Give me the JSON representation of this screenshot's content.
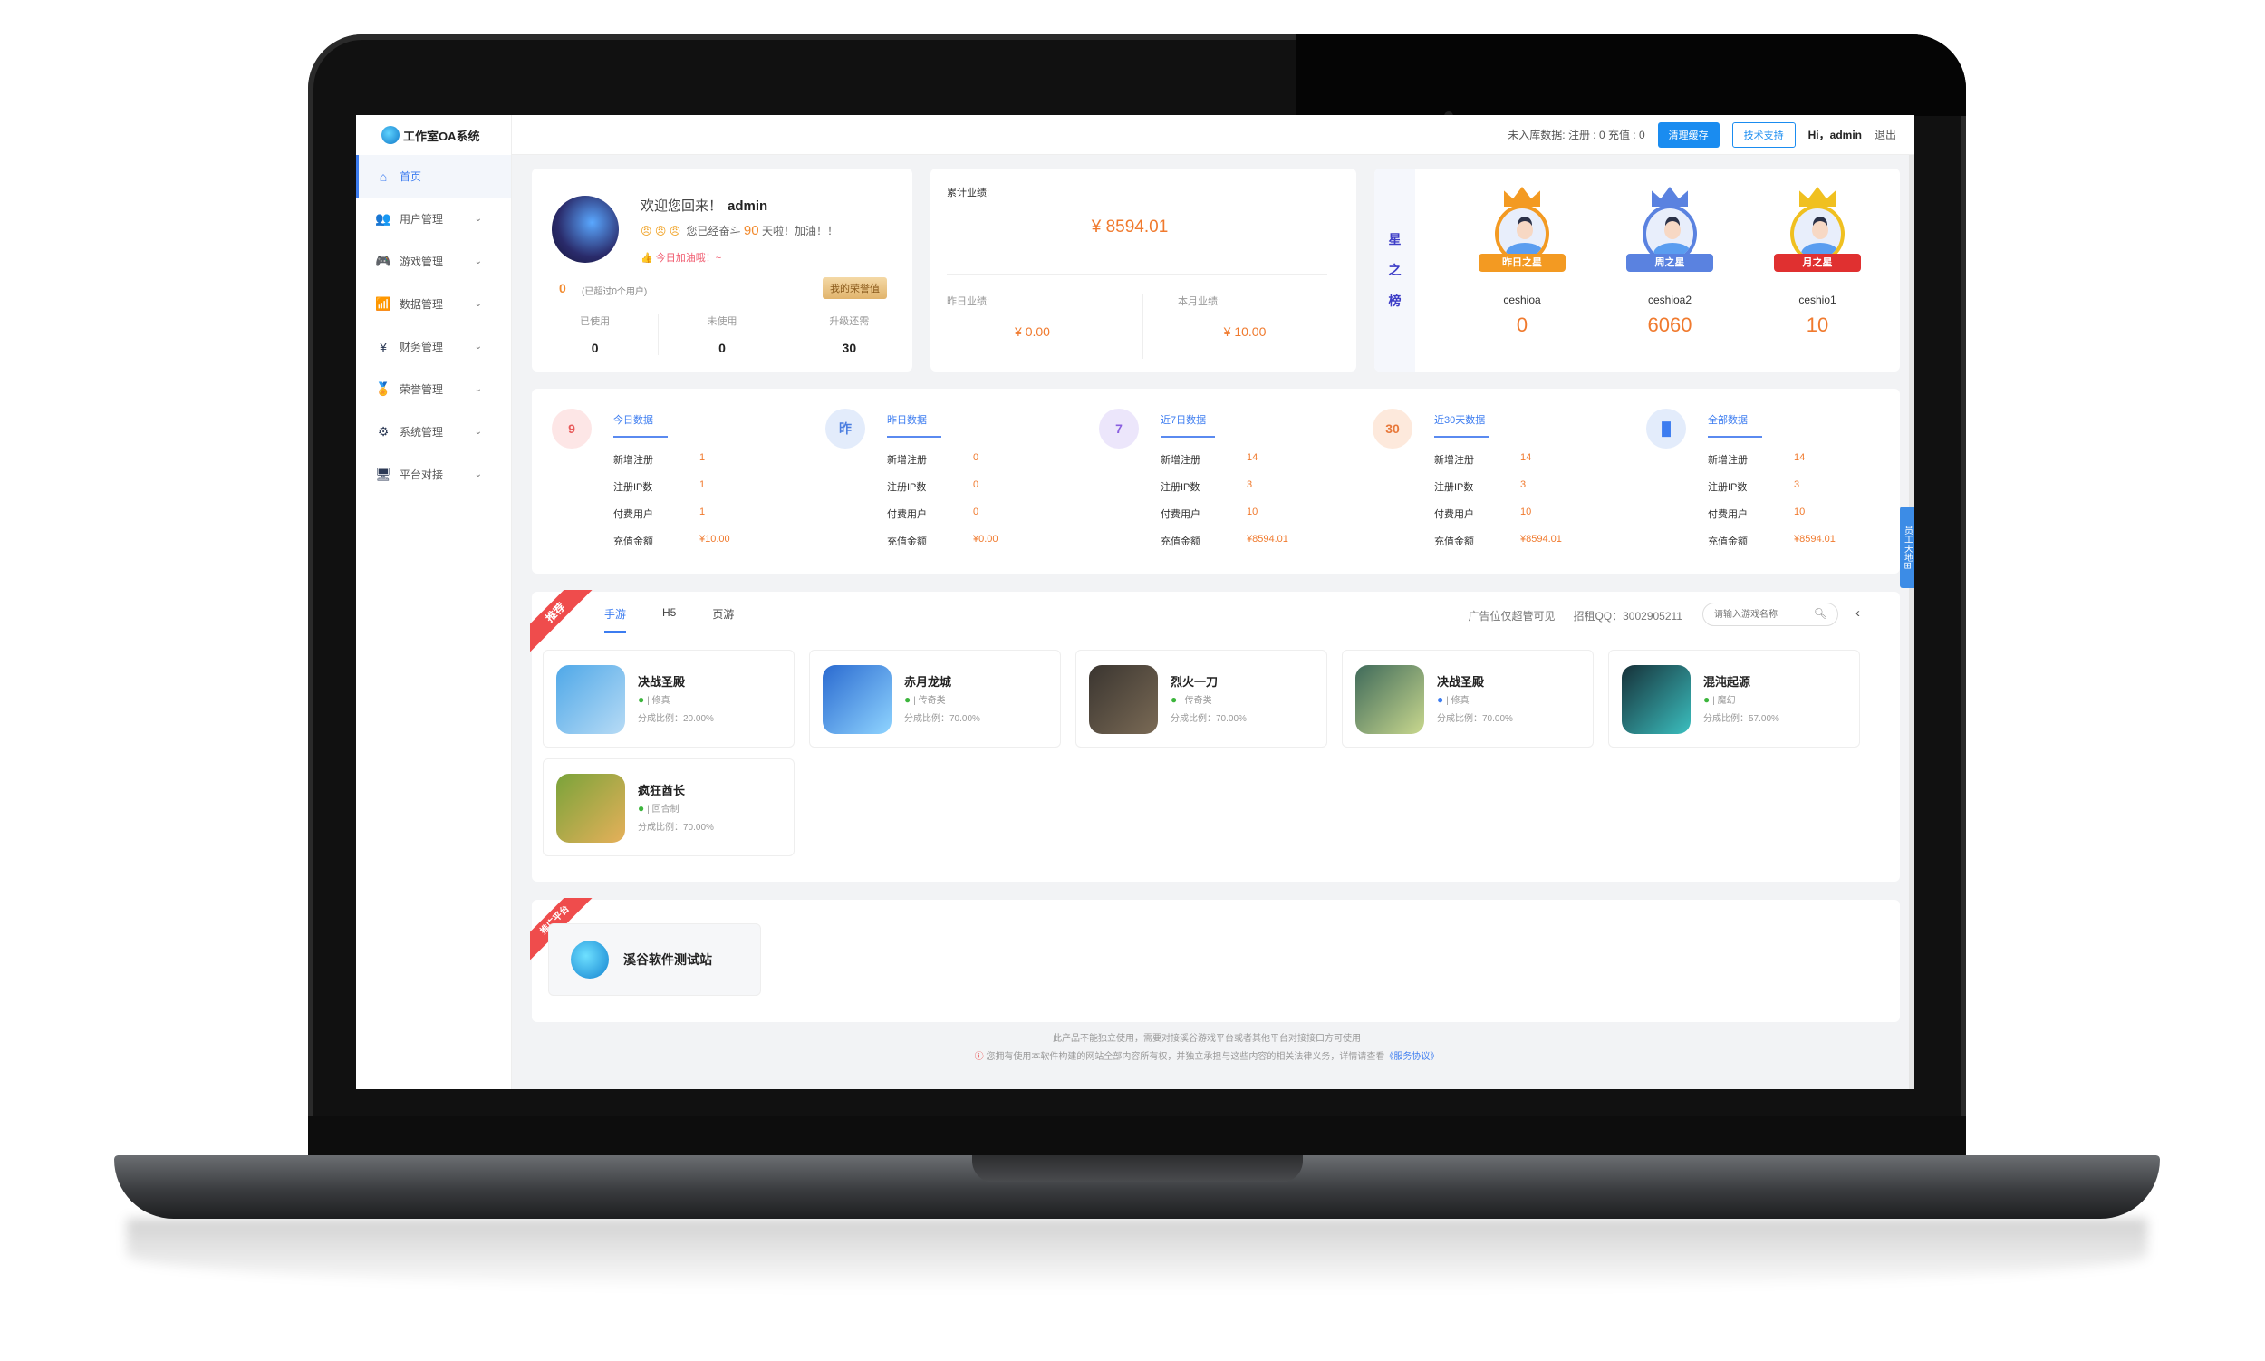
{
  "app": {
    "title": "工作室OA系统"
  },
  "sidebar": {
    "items": [
      {
        "label": "首页",
        "icon": "home-icon",
        "active": true
      },
      {
        "label": "用户管理",
        "icon": "users-icon"
      },
      {
        "label": "游戏管理",
        "icon": "gamepad-icon"
      },
      {
        "label": "数据管理",
        "icon": "chart-icon"
      },
      {
        "label": "财务管理",
        "icon": "yuan-icon"
      },
      {
        "label": "荣誉管理",
        "icon": "medal-icon"
      },
      {
        "label": "系统管理",
        "icon": "gear-icon"
      },
      {
        "label": "平台对接",
        "icon": "monitor-icon"
      }
    ]
  },
  "topbar": {
    "pending": "未入库数据: 注册 : 0 充值 : 0",
    "clear_cache": "清理缓存",
    "tech_support": "技术支持",
    "greeting": "Hi，admin",
    "logout": "退出"
  },
  "user_card": {
    "welcome": "欢迎您回来！",
    "username": "admin",
    "emojis": "😠 😠 😠",
    "fight_prefix": "您已经奋斗",
    "days": "90",
    "fight_suffix": "天啦！加油！！",
    "cheer": "👍 今日加油哦！~",
    "score": "0",
    "score_sub": "(已超过0个用户)",
    "honor_button": "我的荣誉值",
    "stats": [
      {
        "label": "已使用",
        "value": "0"
      },
      {
        "label": "未使用",
        "value": "0"
      },
      {
        "label": "升级还需",
        "value": "30"
      }
    ]
  },
  "performance": {
    "total_label": "累计业绩:",
    "total_value": "¥ 8594.01",
    "yesterday_label": "昨日业绩:",
    "yesterday_value": "¥ 0.00",
    "month_label": "本月业绩:",
    "month_value": "¥ 10.00"
  },
  "stars": {
    "side_title": [
      "星",
      "之",
      "榜"
    ],
    "items": [
      {
        "ribbon": "昨日之星",
        "name": "ceshioa",
        "value": "0",
        "color": "#f39a22"
      },
      {
        "ribbon": "周之星",
        "name": "ceshioa2",
        "value": "6060",
        "color": "#5a82e0"
      },
      {
        "ribbon": "月之星",
        "name": "ceshio1",
        "value": "10",
        "color": "#f0c020",
        "ribbon_color": "#e03030"
      }
    ]
  },
  "data_blocks": [
    {
      "title": "今日数据",
      "icon": "calendar-today-icon",
      "glyph": "9",
      "bg": "#fde6e6",
      "fg": "#e85a5a",
      "rows": [
        {
          "label": "新增注册",
          "value": "1"
        },
        {
          "label": "注册IP数",
          "value": "1"
        },
        {
          "label": "付费用户",
          "value": "1"
        },
        {
          "label": "充值金额",
          "value": "¥10.00"
        }
      ]
    },
    {
      "title": "昨日数据",
      "icon": "calendar-yesterday-icon",
      "glyph": "昨",
      "bg": "#e3ecfb",
      "fg": "#4a7de0",
      "rows": [
        {
          "label": "新增注册",
          "value": "0"
        },
        {
          "label": "注册IP数",
          "value": "0"
        },
        {
          "label": "付费用户",
          "value": "0"
        },
        {
          "label": "充值金额",
          "value": "¥0.00"
        }
      ]
    },
    {
      "title": "近7日数据",
      "icon": "calendar-7-icon",
      "glyph": "7",
      "bg": "#ece6fb",
      "fg": "#8a5ee0",
      "rows": [
        {
          "label": "新增注册",
          "value": "14"
        },
        {
          "label": "注册IP数",
          "value": "3"
        },
        {
          "label": "付费用户",
          "value": "10"
        },
        {
          "label": "充值金额",
          "value": "¥8594.01"
        }
      ]
    },
    {
      "title": "近30天数据",
      "icon": "calendar-30-icon",
      "glyph": "30",
      "bg": "#fde9dc",
      "fg": "#e8783a",
      "rows": [
        {
          "label": "新增注册",
          "value": "14"
        },
        {
          "label": "注册IP数",
          "value": "3"
        },
        {
          "label": "付费用户",
          "value": "10"
        },
        {
          "label": "充值金额",
          "value": "¥8594.01"
        }
      ]
    },
    {
      "title": "全部数据",
      "icon": "bar-chart-icon",
      "glyph": "▐▌",
      "bg": "#e3ecfb",
      "fg": "#3c7cf0",
      "rows": [
        {
          "label": "新增注册",
          "value": "14"
        },
        {
          "label": "注册IP数",
          "value": "3"
        },
        {
          "label": "付费用户",
          "value": "10"
        },
        {
          "label": "充值金额",
          "value": "¥8594.01"
        }
      ]
    }
  ],
  "games": {
    "tag": "推荐",
    "tabs": [
      {
        "label": "手游",
        "active": true
      },
      {
        "label": "H5"
      },
      {
        "label": "页游"
      }
    ],
    "ad_notice": "广告位仅超管可见",
    "qq": "招租QQ：3002905211",
    "search_placeholder": "请输入游戏名称",
    "items": [
      {
        "name": "决战圣殿",
        "platform": "android",
        "category": "修真",
        "share": "分成比例：20.00%",
        "colors": [
          "#4fa8e8",
          "#b7dbf5"
        ]
      },
      {
        "name": "赤月龙城",
        "platform": "android",
        "category": "传奇类",
        "share": "分成比例：70.00%",
        "colors": [
          "#2a6ad0",
          "#8fd4ff"
        ]
      },
      {
        "name": "烈火一刀",
        "platform": "android",
        "category": "传奇类",
        "share": "分成比例：70.00%",
        "colors": [
          "#3a3530",
          "#7a6a55"
        ]
      },
      {
        "name": "决战圣殿",
        "platform": "ios",
        "category": "修真",
        "share": "分成比例：70.00%",
        "colors": [
          "#3f6a5a",
          "#c9d88e"
        ]
      },
      {
        "name": "混沌起源",
        "platform": "android",
        "category": "魔幻",
        "share": "分成比例：57.00%",
        "colors": [
          "#163038",
          "#3bbfbf"
        ]
      },
      {
        "name": "疯狂酋长",
        "platform": "android",
        "category": "回合制",
        "share": "分成比例：70.00%",
        "colors": [
          "#7aa33a",
          "#e6b05a"
        ]
      }
    ]
  },
  "promo": {
    "tag": "推广平台",
    "item": "溪谷软件测试站"
  },
  "footer": {
    "line1": "此产品不能独立使用，需要对接溪谷游戏平台或者其他平台对接接口方可使用",
    "line2": "您拥有使用本软件构建的网站全部内容所有权，并独立承担与这些内容的相关法律义务，详情请查看",
    "link": "《服务协议》"
  },
  "side_tab": "员工天地"
}
